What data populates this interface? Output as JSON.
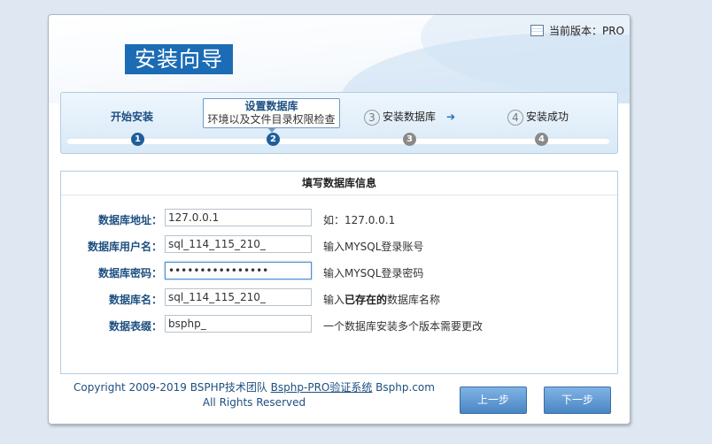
{
  "header": {
    "logo_text": "安装向导",
    "version_label": "当前版本：PRO"
  },
  "steps": [
    {
      "number": "1",
      "label": "开始安装",
      "sublabel": "",
      "state": "done"
    },
    {
      "number": "2",
      "label": "设置数据库",
      "sublabel": "环境以及文件目录权限检查",
      "state": "active"
    },
    {
      "number": "3",
      "label": "安装数据库",
      "sublabel": "",
      "state": "pending"
    },
    {
      "number": "4",
      "label": "安装成功",
      "sublabel": "",
      "state": "pending"
    }
  ],
  "steps_arrow": "➔",
  "form": {
    "title": "填写数据库信息",
    "fields": [
      {
        "label": "数据库地址：",
        "value": "127.0.0.1",
        "hint": "如：127.0.0.1"
      },
      {
        "label": "数据库用户名：",
        "value": "sql_114_115_210_",
        "hint": "输入MYSQL登录账号"
      },
      {
        "label": "数据库密码：",
        "value": "••••••••••••••••",
        "hint": "输入MYSQL登录密码"
      },
      {
        "label": "数据库名：",
        "value": "sql_114_115_210_",
        "hint_pre": "输入",
        "hint_bold": "已存在的",
        "hint_post": "数据库名称"
      },
      {
        "label": "数据表缀：",
        "value": "bsphp_",
        "hint": "一个数据库安装多个版本需要更改"
      }
    ]
  },
  "footer": {
    "copyright_pre": "Copyright 2009-2019 BSPHP技术团队 ",
    "link_text": "Bsphp-PRO验证系统",
    "copyright_post": " Bsphp.com",
    "rights": "All Rights Reserved"
  },
  "buttons": {
    "prev_label": "上一步",
    "next_label": "下一步"
  },
  "colors": {
    "accent": "#1b6cb5",
    "label_blue": "#1d4f80",
    "button_top": "#7fb3e4",
    "button_bottom": "#4a86c4"
  }
}
